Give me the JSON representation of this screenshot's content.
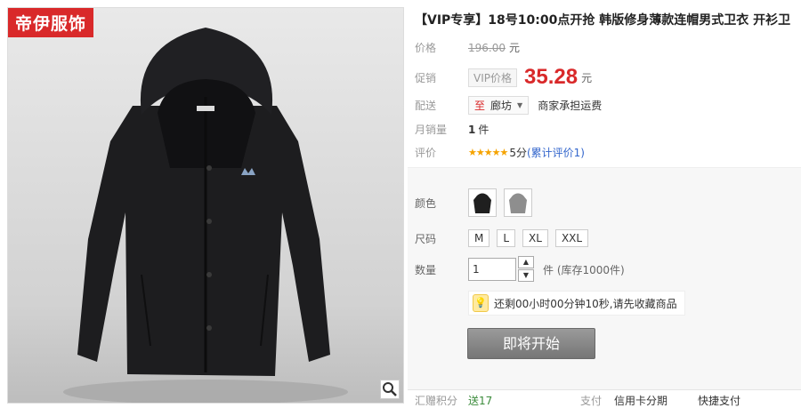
{
  "brand": "帝伊服饰",
  "title": "【VIP专享】18号10:00点开抢 韩版修身薄款连帽男式卫衣 开衫卫",
  "price": {
    "label": "价格",
    "original": "196.00",
    "unit": "元"
  },
  "promo": {
    "label": "促销",
    "vip_tag": "VIP价格",
    "price": "35.28",
    "unit": "元"
  },
  "shipping": {
    "label": "配送",
    "location": "廊坊",
    "note": "商家承担运费"
  },
  "sales": {
    "label": "月销量",
    "count": "1",
    "unit": "件"
  },
  "rating": {
    "label": "评价",
    "stars": "★★★★★",
    "score": "5分",
    "review_text": "(累计评价",
    "review_count": "1",
    "review_close": ")"
  },
  "color": {
    "label": "颜色"
  },
  "size": {
    "label": "尺码",
    "options": [
      "M",
      "L",
      "XL",
      "XXL"
    ]
  },
  "quantity": {
    "label": "数量",
    "value": "1",
    "stock": "件 (库存1000件)"
  },
  "notice": "还剩00小时00分钟10秒,请先收藏商品",
  "start_button": "即将开始",
  "bottom": {
    "points_label": "汇赠积分",
    "points_value": "送17",
    "pay_label": "支付",
    "installment": "信用卡分期",
    "quick_pay": "快捷支付"
  }
}
